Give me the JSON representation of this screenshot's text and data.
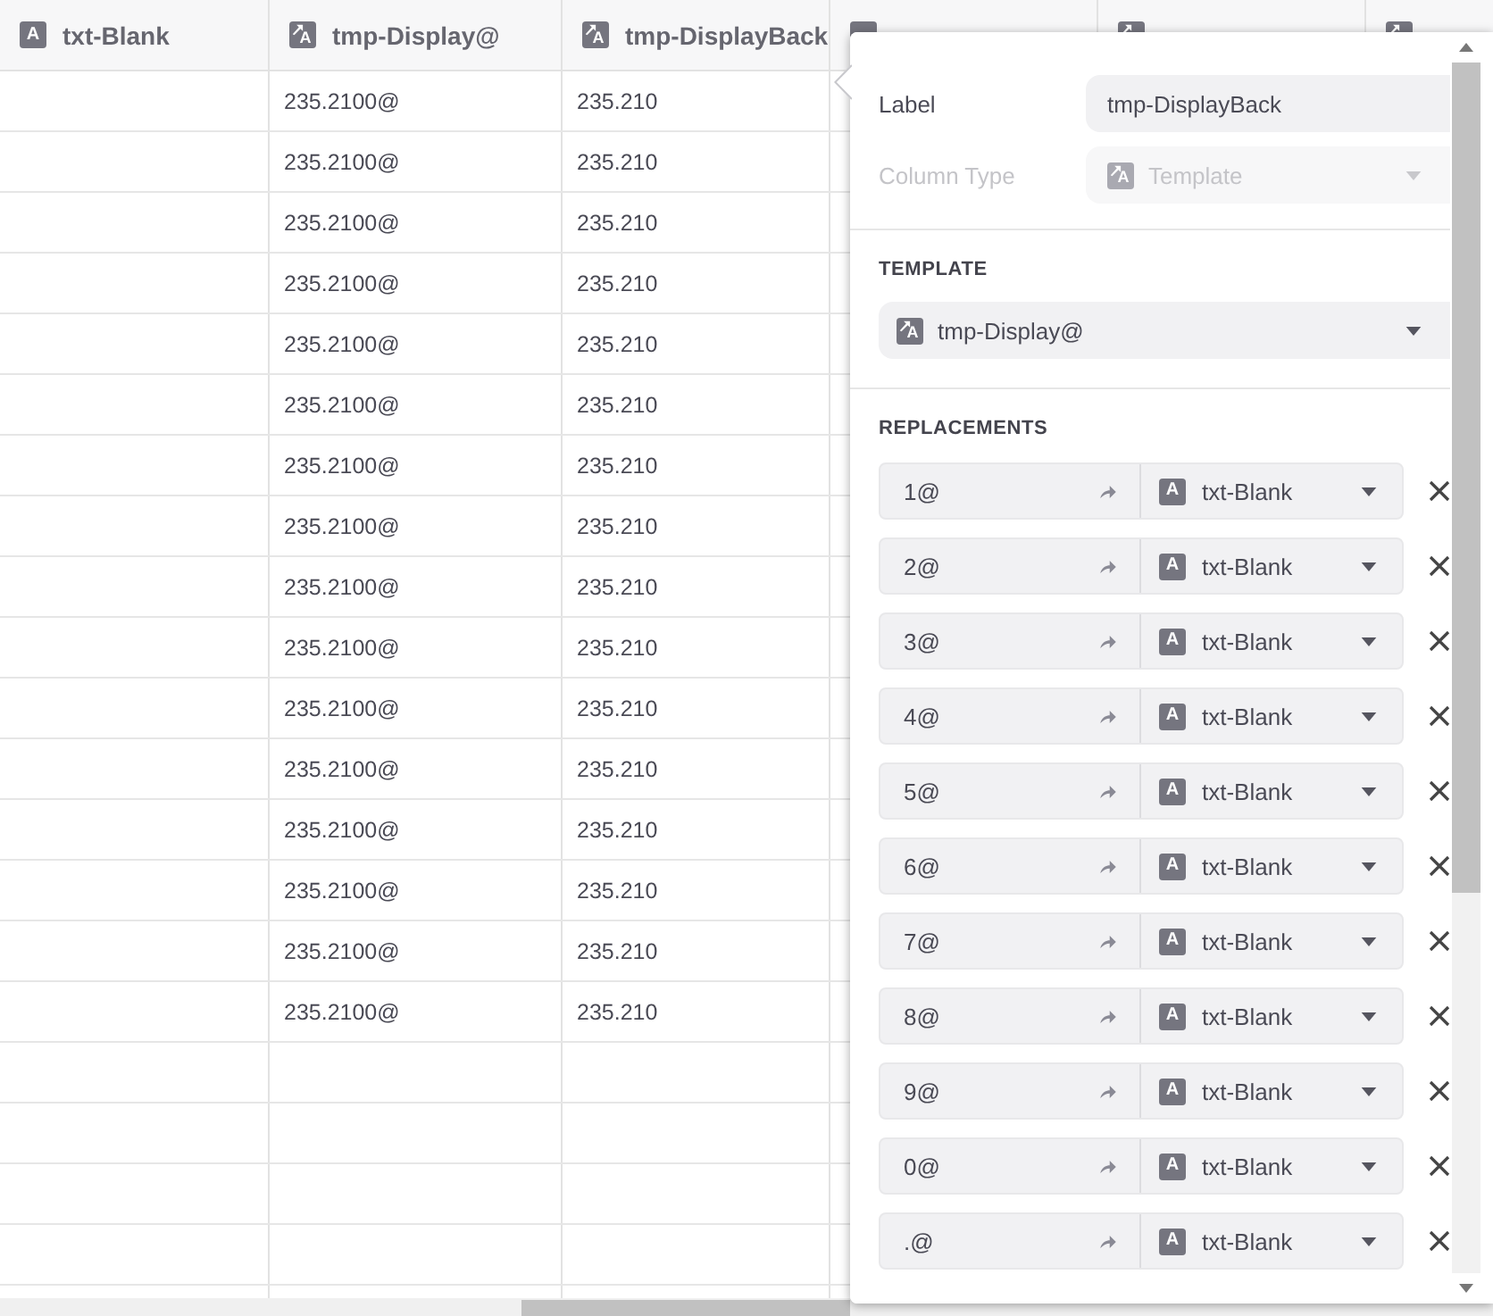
{
  "table": {
    "columns": [
      {
        "label": "txt-Blank",
        "kind": "text",
        "icon_letter": "A"
      },
      {
        "label": "tmp-Display@",
        "kind": "template",
        "icon_letter": "A"
      },
      {
        "label": "tmp-DisplayBack",
        "kind": "template",
        "icon_letter": "A"
      },
      {
        "kind": "text"
      },
      {
        "kind": "template"
      },
      {
        "kind": "template"
      }
    ],
    "rows": [
      {
        "display": "235.2100@",
        "display_back": "235.210"
      },
      {
        "display": "235.2100@",
        "display_back": "235.210"
      },
      {
        "display": "235.2100@",
        "display_back": "235.210"
      },
      {
        "display": "235.2100@",
        "display_back": "235.210"
      },
      {
        "display": "235.2100@",
        "display_back": "235.210"
      },
      {
        "display": "235.2100@",
        "display_back": "235.210"
      },
      {
        "display": "235.2100@",
        "display_back": "235.210"
      },
      {
        "display": "235.2100@",
        "display_back": "235.210"
      },
      {
        "display": "235.2100@",
        "display_back": "235.210"
      },
      {
        "display": "235.2100@",
        "display_back": "235.210"
      },
      {
        "display": "235.2100@",
        "display_back": "235.210"
      },
      {
        "display": "235.2100@",
        "display_back": "235.210"
      },
      {
        "display": "235.2100@",
        "display_back": "235.210"
      },
      {
        "display": "235.2100@",
        "display_back": "235.210"
      },
      {
        "display": "235.2100@",
        "display_back": "235.210"
      },
      {
        "display": "235.2100@",
        "display_back": "235.210"
      }
    ]
  },
  "column_editor": {
    "fields": [
      {
        "label": "Label",
        "value": "tmp-DisplayBack",
        "kind": "input",
        "disabled": false
      },
      {
        "label": "Column Type",
        "value": "Template",
        "kind": "select",
        "icon_letter": "A",
        "disabled": true
      }
    ],
    "template": {
      "heading": "TEMPLATE",
      "value": "tmp-Display@",
      "icon_letter": "A"
    },
    "replacements": {
      "heading": "REPLACEMENTS",
      "items": [
        {
          "key": "1@",
          "target": "txt-Blank",
          "icon_letter": "A"
        },
        {
          "key": "2@",
          "target": "txt-Blank",
          "icon_letter": "A"
        },
        {
          "key": "3@",
          "target": "txt-Blank",
          "icon_letter": "A"
        },
        {
          "key": "4@",
          "target": "txt-Blank",
          "icon_letter": "A"
        },
        {
          "key": "5@",
          "target": "txt-Blank",
          "icon_letter": "A"
        },
        {
          "key": "6@",
          "target": "txt-Blank",
          "icon_letter": "A"
        },
        {
          "key": "7@",
          "target": "txt-Blank",
          "icon_letter": "A"
        },
        {
          "key": "8@",
          "target": "txt-Blank",
          "icon_letter": "A"
        },
        {
          "key": "9@",
          "target": "txt-Blank",
          "icon_letter": "A"
        },
        {
          "key": "0@",
          "target": "txt-Blank",
          "icon_letter": "A"
        },
        {
          "key": ".@",
          "target": "txt-Blank",
          "icon_letter": "A"
        }
      ]
    }
  }
}
